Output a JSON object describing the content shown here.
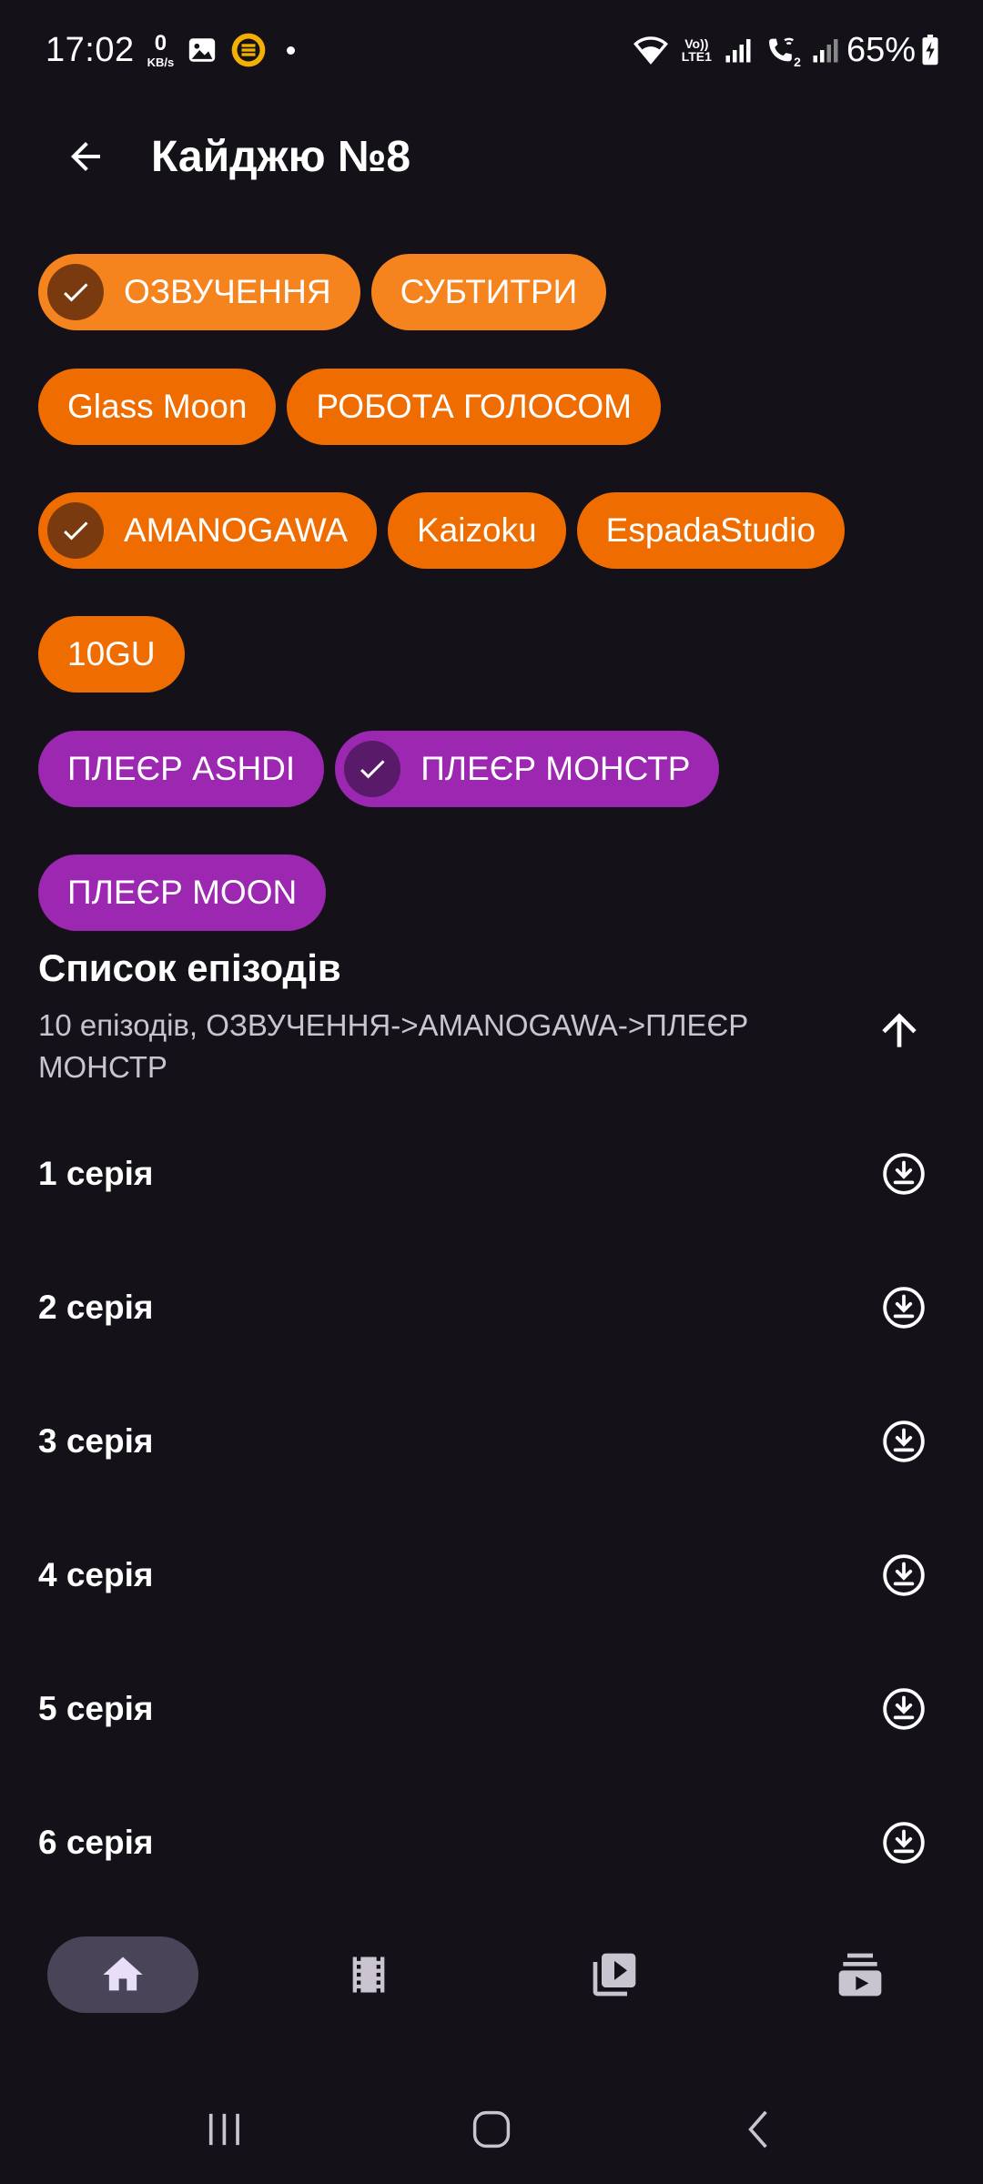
{
  "status_bar": {
    "time": "17:02",
    "net_speed_value": "0",
    "net_speed_unit": "KB/s",
    "lte_label_top": "Vo))",
    "lte_label_bottom": "LTE1",
    "sim2_label": "2",
    "battery": "65%"
  },
  "header": {
    "title": "Кайджю №8"
  },
  "filters": {
    "type_chips": [
      {
        "label": "ОЗВУЧЕННЯ",
        "selected": true
      },
      {
        "label": "СУБТИТРИ",
        "selected": false
      }
    ],
    "studio_chips": [
      {
        "label": "Glass Moon",
        "selected": false
      },
      {
        "label": "РОБОТА ГОЛОСОМ",
        "selected": false
      },
      {
        "label": "AMANOGAWA",
        "selected": true
      },
      {
        "label": "Kaizoku",
        "selected": false
      },
      {
        "label": "EspadaStudio",
        "selected": false
      },
      {
        "label": "10GU",
        "selected": false
      }
    ],
    "player_chips": [
      {
        "label": "ПЛЕЄР ASHDI",
        "selected": false
      },
      {
        "label": "ПЛЕЄР МОНСТР",
        "selected": true
      },
      {
        "label": "ПЛЕЄР MOON",
        "selected": false
      }
    ]
  },
  "episodes": {
    "title": "Список епізодів",
    "subtitle": "10 епізодів, ОЗВУЧЕННЯ->AMANOGAWA->ПЛЕЄР МОНСТР",
    "items": [
      {
        "label": "1 серія"
      },
      {
        "label": "2 серія"
      },
      {
        "label": "3 серія"
      },
      {
        "label": "4 серія"
      },
      {
        "label": "5 серія"
      },
      {
        "label": "6 серія"
      }
    ]
  },
  "colors": {
    "background": "#141218",
    "chip_orange": "#ef6c00",
    "chip_orange_light": "#f5841e",
    "chip_purple": "#9c27b0",
    "nav_active": "#4a4458"
  },
  "bottom_nav": [
    {
      "icon": "home-icon",
      "active": true
    },
    {
      "icon": "film-icon",
      "active": false
    },
    {
      "icon": "video-library-icon",
      "active": false
    },
    {
      "icon": "subscriptions-icon",
      "active": false
    }
  ]
}
